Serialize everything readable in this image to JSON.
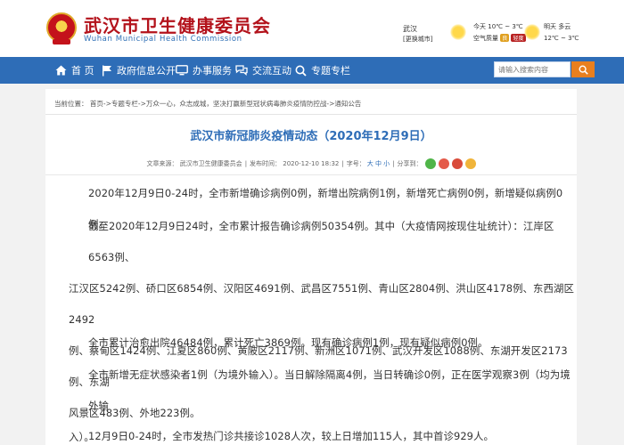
{
  "header": {
    "title": "武汉市卫生健康委员会",
    "subtitle": "Wuhan Municipal Health Commission",
    "weather": {
      "city": "武汉",
      "city_note": "[更换城市]",
      "today_label": "今天",
      "today_temp": "10℃ ~ 3℃",
      "aq_label": "空气质量",
      "aq_badge1": "良",
      "aq_badge2": "轻度",
      "tomorrow_label": "明天",
      "tomorrow_weather": "多云",
      "tomorrow_temp": "12℃ ~ 3℃"
    }
  },
  "nav": {
    "items": [
      {
        "label": "首 页",
        "icon": "home-icon"
      },
      {
        "label": "政府信息公开",
        "icon": "flag-icon"
      },
      {
        "label": "办事服务",
        "icon": "monitor-icon"
      },
      {
        "label": "交流互动",
        "icon": "chat-icon"
      },
      {
        "label": "专题专栏",
        "icon": "search-icon"
      }
    ],
    "search_placeholder": "请输入搜索内容",
    "colors": {
      "nav": "#2e6db7",
      "search_button": "#e87f1e",
      "title_red": "#b3121b"
    }
  },
  "breadcrumb": "当前位置： 首页->专题专栏->万众一心，众志成城，坚决打赢新型冠状病毒肺炎疫情防控战->通知公告",
  "article": {
    "title": "武汉市新冠肺炎疫情动态（2020年12月9日）",
    "meta": {
      "source": "文章来源： 武汉市卫生健康委员会",
      "published": "发布时间： 2020-12-10 18:32",
      "font_label": "字号：",
      "font_sizes": "大 中 小",
      "share": "分享到："
    },
    "paragraphs": [
      [
        "2020年12月9日0-24时，全市新增确诊病例0例，新增出院病例1例，新增死亡病例0例，新增疑似病例0例。"
      ],
      [
        "截至2020年12月9日24时，全市累计报告确诊病例50354例。其中（大疫情网按现住址统计）：江岸区6563例、",
        "江汉区5242例、硚口区6854例、汉阳区4691例、武昌区7551例、青山区2804例、洪山区4178例、东西湖区2492",
        "例、蔡甸区1424例、江夏区860例、黄陂区2117例、新洲区1071例、武汉开发区1088例、东湖开发区2173例、东湖",
        "风景区483例、外地223例。"
      ],
      [
        "全市累计治愈出院46484例，累计死亡3869例。现有确诊病例1例，现有疑似病例0例。"
      ],
      [
        "全市新增无症状感染者1例（为境外输入）。当日解除隔离4例，当日转确诊0例，正在医学观察3例（均为境外输",
        "入）。"
      ],
      [
        "12月9日0-24时，全市发热门诊共接诊1028人次，较上日增加115人，其中首诊929人。"
      ]
    ]
  }
}
